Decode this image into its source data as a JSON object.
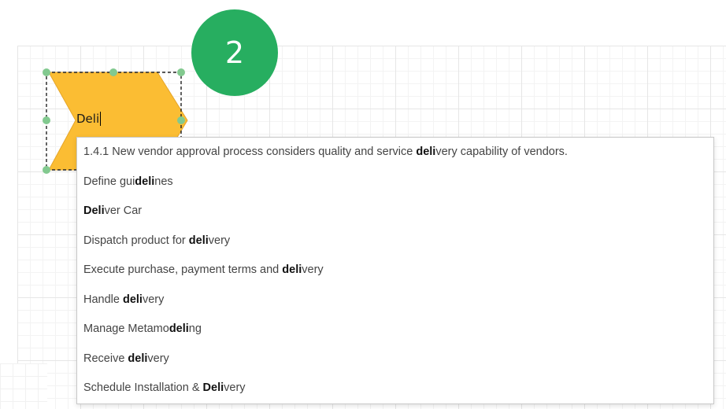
{
  "step_badge": {
    "number": "2",
    "color": "#27ae60"
  },
  "shape": {
    "type": "chevron",
    "fill_color": "#fbbd33",
    "text_value": "Deli",
    "handle_color": "#82c98f"
  },
  "autocomplete": {
    "query": "deli",
    "items": [
      {
        "pre": "1.4.1 New vendor approval process considers quality and service ",
        "match": "deli",
        "post": "very capability of vendors."
      },
      {
        "pre": "Define gui",
        "match": "deli",
        "post": "nes"
      },
      {
        "pre": "",
        "match": "Deli",
        "post": "ver Car"
      },
      {
        "pre": "Dispatch product for ",
        "match": "deli",
        "post": "very"
      },
      {
        "pre": "Execute purchase, payment terms and ",
        "match": "deli",
        "post": "very"
      },
      {
        "pre": "Handle ",
        "match": "deli",
        "post": "very"
      },
      {
        "pre": "Manage Metamo",
        "match": "deli",
        "post": "ng"
      },
      {
        "pre": "Receive ",
        "match": "deli",
        "post": "very"
      },
      {
        "pre": "Schedule Installation & ",
        "match": "Deli",
        "post": "very"
      }
    ]
  }
}
